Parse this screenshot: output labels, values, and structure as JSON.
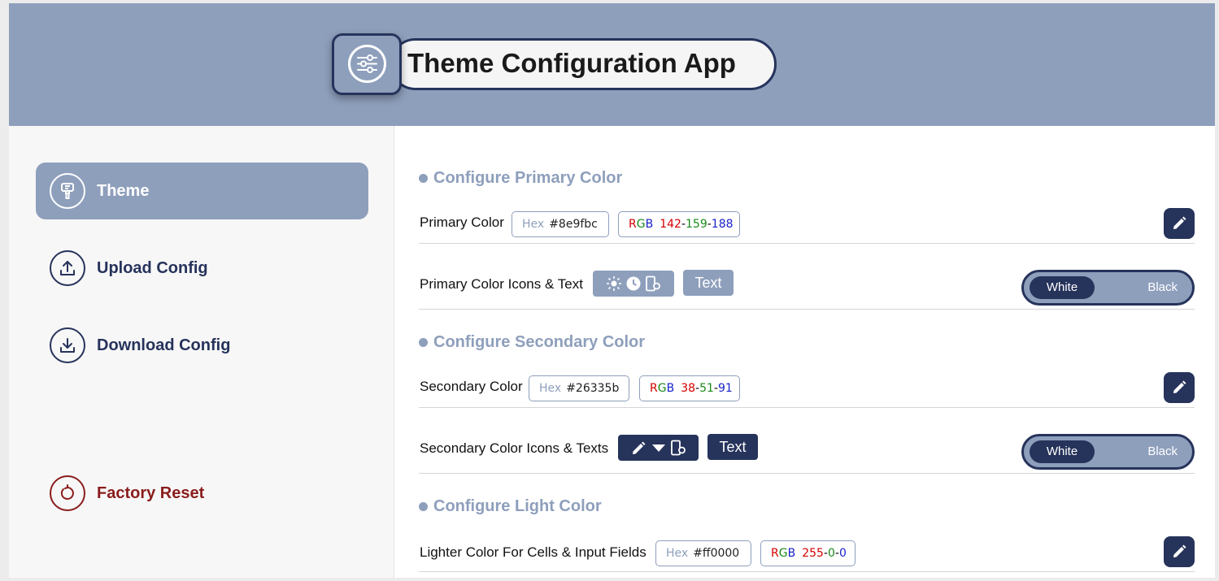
{
  "app": {
    "title": "Theme Configuration App"
  },
  "sidebar": {
    "items": [
      {
        "label": "Theme",
        "icon": "paint-roller-icon",
        "active": true
      },
      {
        "label": "Upload Config",
        "icon": "upload-icon"
      },
      {
        "label": "Download Config",
        "icon": "download-icon"
      },
      {
        "label": "Factory Reset",
        "icon": "reset-icon"
      }
    ]
  },
  "primary": {
    "section_title": "Configure Primary Color",
    "color_label": "Primary Color",
    "hex_tag": "Hex",
    "hex_value": "#8e9fbc",
    "rgb_r": "142",
    "rgb_g": "159",
    "rgb_b": "188",
    "icons_text_label": "Primary Color Icons & Text",
    "text_chip": "Text",
    "toggle_on": "White",
    "toggle_off": "Black"
  },
  "secondary": {
    "section_title": "Configure Secondary Color",
    "color_label": "Secondary Color",
    "hex_tag": "Hex",
    "hex_value": "#26335b",
    "rgb_r": "38",
    "rgb_g": "51",
    "rgb_b": "91",
    "icons_text_label": "Secondary Color Icons & Texts",
    "text_chip": "Text",
    "toggle_on": "White",
    "toggle_off": "Black"
  },
  "light": {
    "section_title": "Configure Light Color",
    "color_label": "Lighter Color For Cells & Input Fields",
    "hex_tag": "Hex",
    "hex_value": "#ff0000",
    "rgb_r": "255",
    "rgb_g": "0",
    "rgb_b": "0"
  },
  "rgb_letters": {
    "r": "R",
    "g": "G",
    "b": "B"
  },
  "colors": {
    "primary": "#8e9fbc",
    "secondary": "#26335b",
    "reset": "#8b1c1c"
  }
}
